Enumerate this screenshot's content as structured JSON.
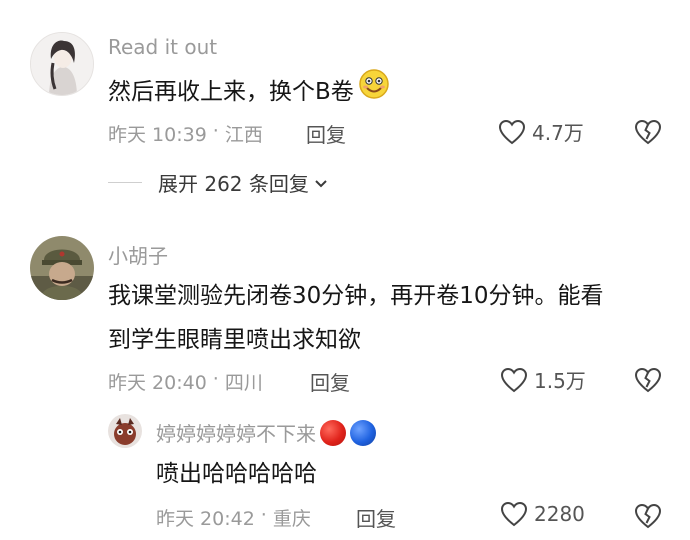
{
  "comments": [
    {
      "username": "Read it out",
      "text": "然后再收上来，换个B卷",
      "emoji": "😉",
      "time": "昨天 10:39",
      "location": "江西",
      "reply_label": "回复",
      "likes": "4.7万",
      "expand_label": "展开 262 条回复"
    },
    {
      "username": "小胡子",
      "text_line1": "我课堂测验先闭卷30分钟，再开卷10分钟。能看",
      "text_line2": "到学生眼睛里喷出求知欲",
      "time": "昨天 20:40",
      "location": "四川",
      "reply_label": "回复",
      "likes": "1.5万"
    }
  ],
  "reply": {
    "username": "婷婷婷婷婷不下来",
    "text": "喷出哈哈哈哈哈",
    "time": "昨天 20:42",
    "location": "重庆",
    "reply_label": "回复",
    "likes": "2280"
  },
  "separator": "·",
  "icons": {
    "like": "heart-outline-icon",
    "dislike": "broken-heart-icon",
    "expand": "chevron-down-icon"
  },
  "colors": {
    "meta": "#9a9a9a",
    "text": "#161616",
    "red_dot": "#e0231b",
    "blue_dot": "#1f62e0"
  }
}
